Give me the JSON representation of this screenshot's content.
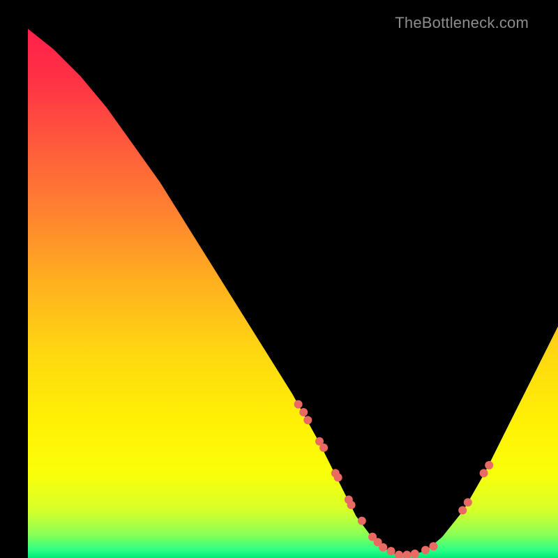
{
  "watermark": "TheBottleneck.com",
  "chart_data": {
    "type": "line",
    "title": "",
    "xlabel": "",
    "ylabel": "",
    "xlim": [
      0,
      100
    ],
    "ylim": [
      0,
      100
    ],
    "grid": false,
    "series": [
      {
        "name": "curve",
        "x": [
          0,
          5,
          10,
          15,
          20,
          25,
          30,
          35,
          40,
          45,
          50,
          55,
          58,
          60,
          62,
          65,
          68,
          70,
          72,
          75,
          78,
          82,
          86,
          90,
          94,
          98,
          100
        ],
        "y": [
          100,
          96,
          91,
          85,
          78,
          71,
          63,
          55,
          47,
          39,
          31,
          22,
          16,
          12,
          8,
          4,
          1.5,
          0.6,
          0.6,
          1.5,
          4,
          9,
          16,
          24,
          32,
          40,
          44
        ]
      }
    ],
    "markers": {
      "name": "points",
      "x": [
        51,
        52,
        52.8,
        55,
        55.8,
        58,
        58.5,
        60.5,
        61,
        63,
        65,
        66,
        67,
        68.5,
        70,
        71.5,
        73,
        75,
        76.5,
        82,
        83,
        86,
        87
      ],
      "y": [
        29,
        27.5,
        26,
        22,
        20.8,
        16,
        15.2,
        11,
        10,
        7,
        4,
        3,
        2,
        1.3,
        0.6,
        0.6,
        0.8,
        1.5,
        2.2,
        9,
        10.5,
        16,
        17.5
      ]
    },
    "gradient_stops": [
      {
        "offset": 0.0,
        "color": "#ff1f4b"
      },
      {
        "offset": 0.1,
        "color": "#ff3246"
      },
      {
        "offset": 0.22,
        "color": "#ff5a3c"
      },
      {
        "offset": 0.35,
        "color": "#ff8330"
      },
      {
        "offset": 0.48,
        "color": "#ffb01f"
      },
      {
        "offset": 0.62,
        "color": "#ffd910"
      },
      {
        "offset": 0.75,
        "color": "#fff205"
      },
      {
        "offset": 0.84,
        "color": "#faff09"
      },
      {
        "offset": 0.91,
        "color": "#d7ff2a"
      },
      {
        "offset": 0.955,
        "color": "#8cff55"
      },
      {
        "offset": 0.985,
        "color": "#2bff86"
      },
      {
        "offset": 1.0,
        "color": "#00e878"
      }
    ],
    "marker_color": "#e86a63",
    "curve_color": "#000000"
  }
}
